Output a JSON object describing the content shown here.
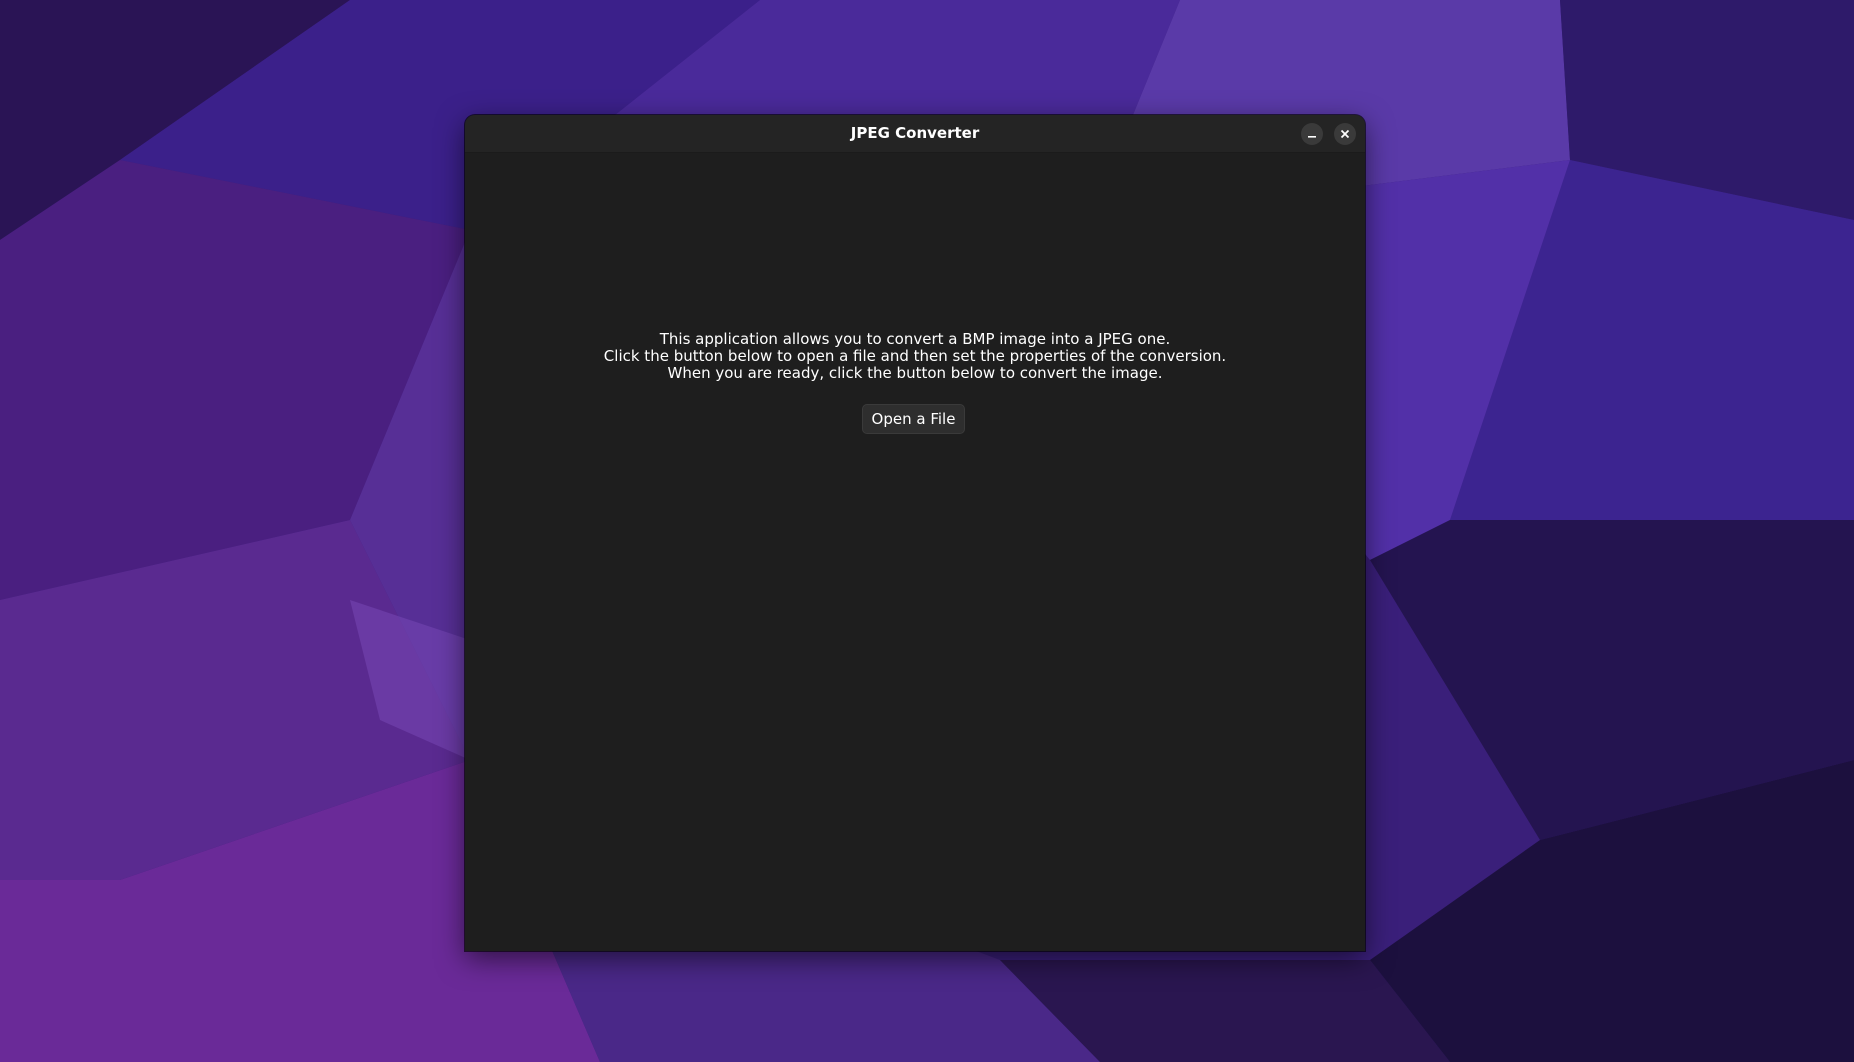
{
  "window": {
    "title": "JPEG Converter"
  },
  "titlebar_buttons": {
    "minimize_icon": "minimize-icon",
    "close_icon": "close-icon"
  },
  "main": {
    "intro_lines": [
      "This application allows you to convert a BMP image into a JPEG one.",
      "Click the button below to open a file and then set the properties of the conversion.",
      "When you are ready, click the button below to convert the image."
    ],
    "open_button_label": "Open a File"
  },
  "colors": {
    "window_background": "#1e1e1e",
    "titlebar_background": "#242424",
    "text": "#ffffff",
    "wallpaper_base": "#3a1f7a"
  }
}
